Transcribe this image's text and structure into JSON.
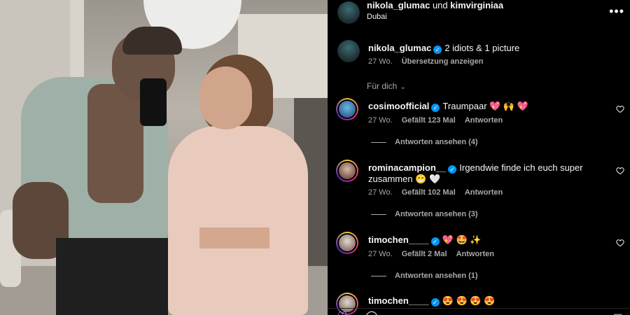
{
  "header": {
    "author": "nikola_glumac",
    "connector": "und",
    "coauthor": "kimvirginiaa",
    "location": "Dubai",
    "more_icon": "more-horizontal-icon"
  },
  "caption": {
    "username": "nikola_glumac",
    "text": "2 idiots & 1 picture",
    "time": "27 Wo.",
    "translate": "Übersetzung anzeigen"
  },
  "sort": {
    "label": "Für dich"
  },
  "comments": [
    {
      "username": "cosimoofficial",
      "text": "Traumpaar 💖 🙌 💖",
      "time": "27 Wo.",
      "likes": "Gefällt 123 Mal",
      "reply": "Antworten",
      "view_replies": "Antworten ansehen (4)"
    },
    {
      "username": "rominacampion__",
      "text": "Irgendwie finde ich euch super",
      "text2": "zusammen 😁 🤍",
      "time": "27 Wo.",
      "likes": "Gefällt 102 Mal",
      "reply": "Antworten",
      "view_replies": "Antworten ansehen (3)"
    },
    {
      "username": "timochen____",
      "text": "💖 🤩 ✨",
      "time": "27 Wo.",
      "likes": "Gefällt 2 Mal",
      "reply": "Antworten",
      "view_replies": "Antworten ansehen (1)"
    },
    {
      "username": "timochen____",
      "text": "😍 😍 😍 😍"
    }
  ],
  "colors": {
    "background": "#000000",
    "text": "#f5f5f5",
    "muted": "#a8a8a8",
    "verified": "#0095f6",
    "heart_red": "#ff3040"
  }
}
